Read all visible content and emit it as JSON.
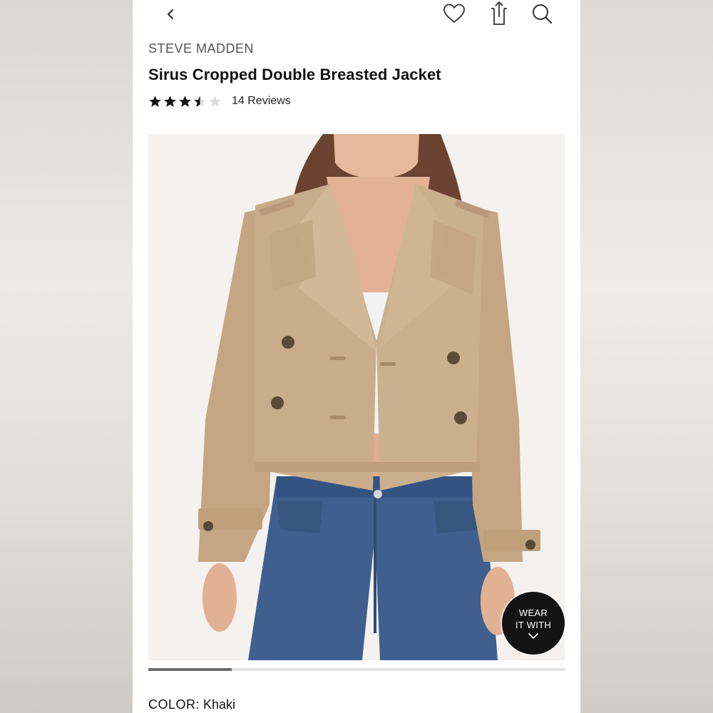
{
  "header": {
    "back_icon": "chevron-left-icon",
    "wishlist_icon": "heart-icon",
    "share_icon": "share-icon",
    "search_icon": "search-icon"
  },
  "product": {
    "brand": "STEVE MADDEN",
    "name": "Sirus Cropped Double Breasted Jacket",
    "rating": 3.5,
    "rating_max": 5,
    "reviews_label": "14 Reviews"
  },
  "gallery": {
    "image_alt": "Model wearing khaki cropped double breasted trench jacket with blue jeans",
    "progress": 0.2,
    "wear_it_with": {
      "label": "WEAR\nIT WITH",
      "icon": "chevron-down-icon"
    }
  },
  "color": {
    "label": "COLOR:",
    "value": "Khaki"
  },
  "colors": {
    "jacket": "#c9ad8a",
    "denim": "#3f5f8e",
    "star": "#111111",
    "star_empty": "#dddddd"
  }
}
